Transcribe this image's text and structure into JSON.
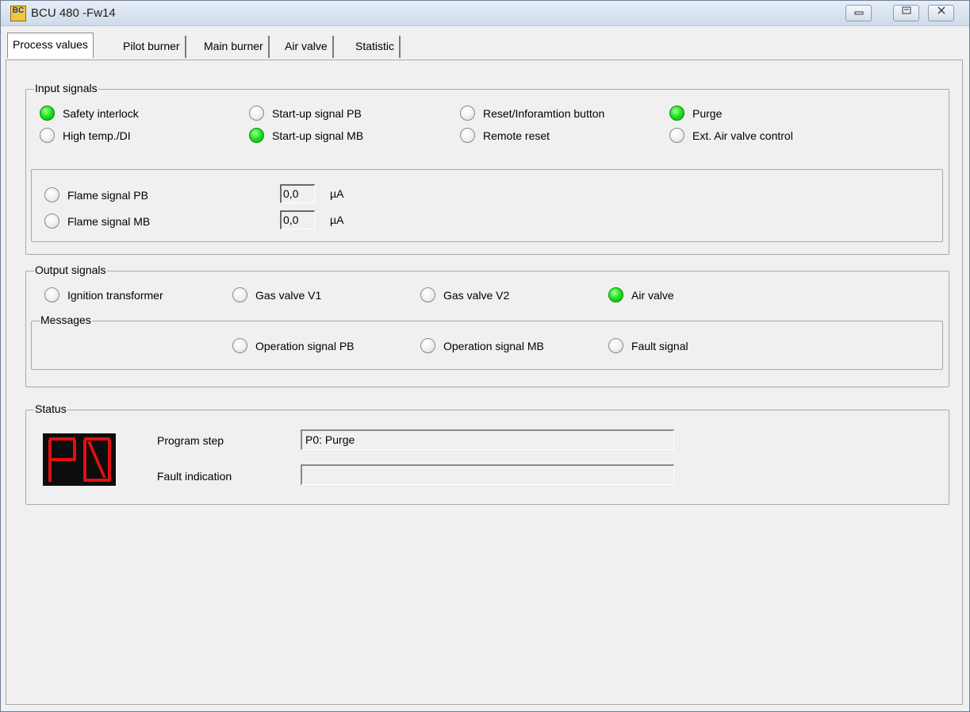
{
  "window": {
    "title": "BCU 480 -Fw14",
    "icon_text": "BC",
    "controls": {
      "minimize": "minimize-icon",
      "restore": "restore-icon",
      "close": "close-icon"
    }
  },
  "tabs": [
    {
      "label": "Process values",
      "active": true
    },
    {
      "label": "Pilot burner",
      "active": false
    },
    {
      "label": "Main burner",
      "active": false
    },
    {
      "label": "Air valve",
      "active": false
    },
    {
      "label": "Statistic",
      "active": false
    }
  ],
  "input_signals": {
    "title": "Input signals",
    "items": [
      {
        "label": "Safety interlock",
        "on": true
      },
      {
        "label": "Start-up signal PB",
        "on": false
      },
      {
        "label": "Reset/Inforamtion button",
        "on": false
      },
      {
        "label": "Purge",
        "on": true
      },
      {
        "label": "High temp./DI",
        "on": false
      },
      {
        "label": "Start-up signal MB",
        "on": true
      },
      {
        "label": "Remote reset",
        "on": false
      },
      {
        "label": "Ext. Air valve control",
        "on": false
      }
    ],
    "flame": [
      {
        "label": "Flame signal PB",
        "on": false,
        "value": "0,0",
        "unit": "µA"
      },
      {
        "label": "Flame signal MB",
        "on": false,
        "value": "0,0",
        "unit": "µA"
      }
    ]
  },
  "output_signals": {
    "title": "Output signals",
    "items": [
      {
        "label": "Ignition transformer",
        "on": false
      },
      {
        "label": "Gas valve V1",
        "on": false
      },
      {
        "label": "Gas valve V2",
        "on": false
      },
      {
        "label": "Air valve",
        "on": true
      }
    ],
    "messages": {
      "title": "Messages",
      "items": [
        {
          "label": "Operation signal PB",
          "on": false
        },
        {
          "label": "Operation signal MB",
          "on": false
        },
        {
          "label": "Fault signal",
          "on": false
        }
      ]
    }
  },
  "status": {
    "title": "Status",
    "display": "P0",
    "display_color": "#e01010",
    "program_step_label": "Program step",
    "program_step_value": "P0: Purge",
    "fault_indication_label": "Fault indication",
    "fault_indication_value": ""
  },
  "colors": {
    "led_on": "#19e019",
    "led_off": "#efefef",
    "segment": "#e01010"
  }
}
